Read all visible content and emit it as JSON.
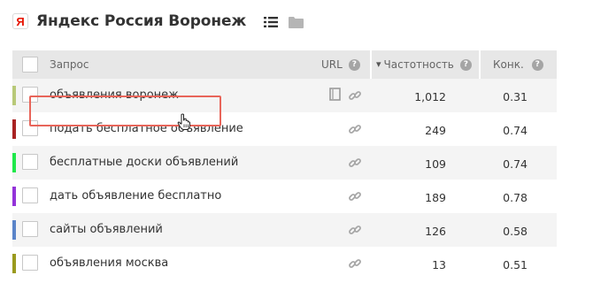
{
  "header": {
    "logo_letter": "Я",
    "title": "Яндекс Россия Воронеж",
    "list_icon": "list-icon",
    "folder_icon": "folder-icon"
  },
  "table": {
    "col_query": "Запрос",
    "col_url": "URL",
    "col_freq": "Частотность",
    "col_conc": "Конк.",
    "sort_indicator": "▾",
    "help": "?",
    "rows": [
      {
        "query": "объявления воронеж",
        "freq": "1,012",
        "conc": "0.31",
        "color": "#b8c978",
        "has_doc": true
      },
      {
        "query": "подать бесплатное объявление",
        "freq": "249",
        "conc": "0.74",
        "color": "#a92323",
        "has_doc": false
      },
      {
        "query": "бесплатные доски объявлений",
        "freq": "109",
        "conc": "0.74",
        "color": "#1fe84a",
        "has_doc": false
      },
      {
        "query": "дать объявление бесплатно",
        "freq": "189",
        "conc": "0.78",
        "color": "#9333d9",
        "has_doc": false
      },
      {
        "query": "сайты объявлений",
        "freq": "126",
        "conc": "0.58",
        "color": "#5a84c9",
        "has_doc": false
      },
      {
        "query": "объявления москва",
        "freq": "13",
        "conc": "0.51",
        "color": "#9a9a1e",
        "has_doc": false
      }
    ]
  },
  "colors": {
    "header_bg": "#e7e7e7",
    "row_alt_bg": "#f4f4f4",
    "highlight": "#e8655a",
    "logo_red": "#e61400"
  }
}
